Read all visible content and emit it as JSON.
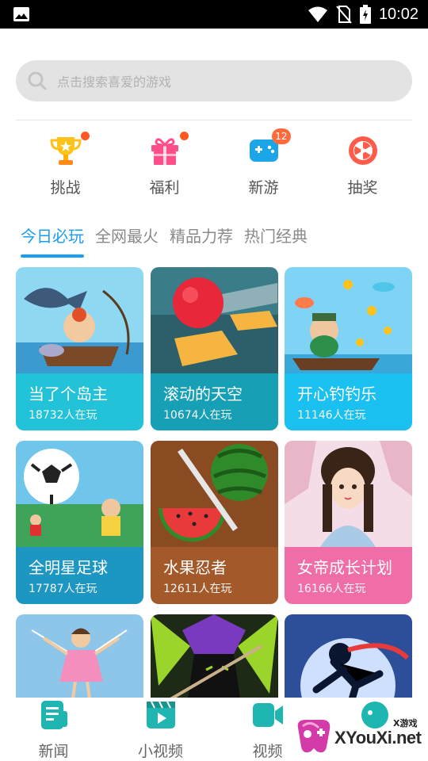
{
  "status_bar": {
    "time": "10:02"
  },
  "search": {
    "placeholder": "点击搜索喜爱的游戏"
  },
  "quick_entries": [
    {
      "label": "挑战",
      "icon": "trophy-icon",
      "has_dot": true
    },
    {
      "label": "福利",
      "icon": "gift-icon",
      "has_dot": true
    },
    {
      "label": "新游",
      "icon": "gamepad-icon",
      "badge": "12"
    },
    {
      "label": "抽奖",
      "icon": "lottery-wheel-icon"
    }
  ],
  "tabs": [
    {
      "label": "今日必玩",
      "active": true
    },
    {
      "label": "全网最火"
    },
    {
      "label": "精品力荐"
    },
    {
      "label": "热门经典"
    }
  ],
  "games": [
    {
      "title": "当了个岛主",
      "players": "18732人在玩",
      "color": "#22c3d8"
    },
    {
      "title": "滚动的天空",
      "players": "10674人在玩",
      "color": "#169fb5"
    },
    {
      "title": "开心钓钓乐",
      "players": "11146人在玩",
      "color": "#19c0f0"
    },
    {
      "title": "全明星足球",
      "players": "17787人在玩",
      "color": "#1d97c2"
    },
    {
      "title": "水果忍者",
      "players": "12611人在玩",
      "color": "#a4592a"
    },
    {
      "title": "女帝成长计划",
      "players": "16166人在玩",
      "color": "#f06ea8"
    },
    {
      "title": "",
      "players": "",
      "color": "#8ec6ea"
    },
    {
      "title": "",
      "players": "",
      "color": "#1d2b16"
    },
    {
      "title": "",
      "players": "",
      "color": "#2d4f9a"
    }
  ],
  "bottom_nav": [
    {
      "label": "新闻",
      "icon": "news-icon"
    },
    {
      "label": "小视频",
      "icon": "short-video-icon"
    },
    {
      "label": "视频",
      "icon": "video-camera-icon"
    },
    {
      "label": "",
      "icon": "game-controller-icon"
    }
  ],
  "watermark": {
    "text": "XYouXi.net",
    "small_text": "X游戏"
  },
  "colors": {
    "accent": "#1a9ef0",
    "badge": "#ff6a3d",
    "icon_teal": "#1fb5b0",
    "dot": "#ff5722"
  }
}
